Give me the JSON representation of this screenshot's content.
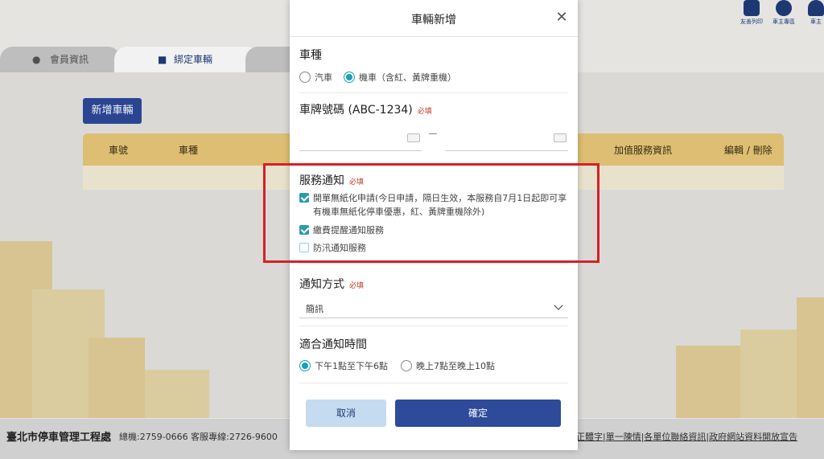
{
  "background": {
    "tabs": [
      {
        "label": "會員資訊"
      },
      {
        "label": "綁定車輛"
      }
    ],
    "add_vehicle_button": "新增車輛",
    "table_headers": [
      "車號",
      "車種",
      "加值服務資訊",
      "編輯 / 刪除"
    ],
    "top_icons": [
      {
        "label": "友善列印",
        "icon": "printer-icon"
      },
      {
        "label": "車主專區",
        "icon": "user-icon"
      },
      {
        "label": "車主",
        "icon": "bell-icon"
      }
    ],
    "footer": {
      "org": "臺北市停車管理工程處",
      "tel": "總機:2759-0666 客服專線:2726-9600",
      "links": "正體字|單一陳情|各單位聯絡資訊|政府網站資料開放宣告"
    }
  },
  "modal": {
    "title": "車輛新增",
    "close_label": "✕",
    "vehicle_type": {
      "label": "車種",
      "options": [
        {
          "label": "汽車",
          "checked": false
        },
        {
          "label": "機車（含紅、黃牌重機）",
          "checked": true
        }
      ]
    },
    "plate": {
      "label": "車牌號碼 (ABC-1234)",
      "required": "必填",
      "part1_placeholder": "",
      "part2_placeholder": ""
    },
    "service_notice": {
      "label": "服務通知",
      "required": "必填",
      "options": [
        {
          "label": "開單無紙化申請(今日申請，隔日生效，本服務自7月1日起即可享有機車無紙化停車優惠，紅、黃牌重機除外)",
          "checked": true
        },
        {
          "label": "繳費提醒通知服務",
          "checked": true
        },
        {
          "label": "防汛通知服務",
          "checked": false
        }
      ]
    },
    "notify_method": {
      "label": "通知方式",
      "required": "必填",
      "selected": "簡訊"
    },
    "notify_time": {
      "label": "適合通知時間",
      "options": [
        {
          "label": "下午1點至下午6點",
          "checked": true
        },
        {
          "label": "晚上7點至晚上10點",
          "checked": false
        }
      ]
    },
    "buttons": {
      "cancel": "取消",
      "confirm": "確定"
    }
  },
  "colors": {
    "primary": "#2d4a9b",
    "accent": "#17a2b8",
    "required": "#c0392b",
    "highlight_frame": "#d81f26"
  }
}
